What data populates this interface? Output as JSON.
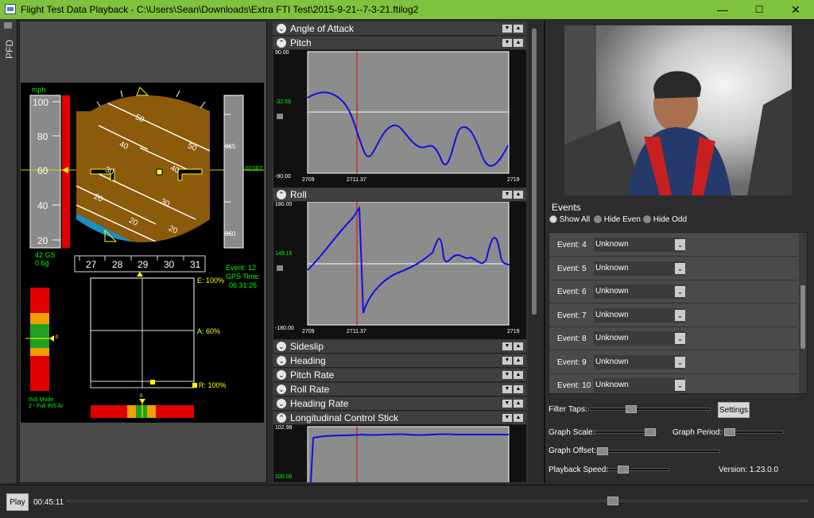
{
  "window": {
    "title": "Flight Test Data Playback - C:\\Users\\Sean\\Downloads\\Extra FTI Test\\2015-9-21--7-3-21.ftilog2",
    "minimize": "—",
    "maximize": "☐",
    "close": "✕"
  },
  "pfd": {
    "tab_label": "PFD",
    "speed_unit": "mph",
    "speed_ticks": [
      "100",
      "80",
      "60",
      "40",
      "20"
    ],
    "gs": "42 GS",
    "g": "0.6g",
    "alt_ticks": [
      "065",
      "060"
    ],
    "alt_value": "00387",
    "pitch_labels": [
      "50",
      "50",
      "40",
      "40",
      "30",
      "30",
      "20",
      "20",
      "20"
    ],
    "heading_ticks": [
      "27",
      "28",
      "29",
      "30",
      "31"
    ],
    "event": "Event: 12",
    "gps_label": "GPS Time:",
    "gps_time": "06:31:26",
    "e_label": "E: 100%",
    "a_label": "A: 60%",
    "r_label": "R: 100%",
    "bar_zero": "0",
    "rudder_zero": "0",
    "ins_mode": "INS Mode:",
    "ins_value": "2 - Full INS Ar"
  },
  "graphs": {
    "headers": [
      "Angle of Attack",
      "Pitch",
      "Roll",
      "Sideslip",
      "Heading",
      "Pitch Rate",
      "Roll Rate",
      "Heading Rate",
      "Longitudinal Control Stick"
    ],
    "pitch": {
      "ymax": "90.00",
      "ymid": "-32.59",
      "ymin": "-90.00",
      "x0": "2709",
      "xc": "2711.37",
      "x1": "2719"
    },
    "roll": {
      "ymax": "180.00",
      "ymid": "149.16",
      "ymin": "-180.00",
      "x0": "2709",
      "xc": "2711.37",
      "x1": "2719"
    },
    "stick": {
      "ymax": "102.98",
      "ymin": "100.00"
    }
  },
  "events": {
    "title": "Events",
    "filters": [
      "Show All",
      "Hide Even",
      "Hide Odd"
    ],
    "rows": [
      {
        "n": "Event: 4",
        "v": "Unknown"
      },
      {
        "n": "Event: 5",
        "v": "Unknown"
      },
      {
        "n": "Event: 6",
        "v": "Unknown"
      },
      {
        "n": "Event: 7",
        "v": "Unknown"
      },
      {
        "n": "Event: 8",
        "v": "Unknown"
      },
      {
        "n": "Event: 9",
        "v": "Unknown"
      },
      {
        "n": "Event: 10",
        "v": "Unknown"
      }
    ]
  },
  "controls": {
    "filter_taps": "Filter Taps:",
    "settings": "Settings",
    "graph_scale": "Graph Scale:",
    "graph_period": "Graph Period:",
    "graph_offset": "Graph Offset:",
    "playback_speed": "Playback Speed:",
    "version": "Version: 1.23.0.0"
  },
  "player": {
    "play": "Play",
    "time": "00:45:11",
    "progress": 0.74
  }
}
